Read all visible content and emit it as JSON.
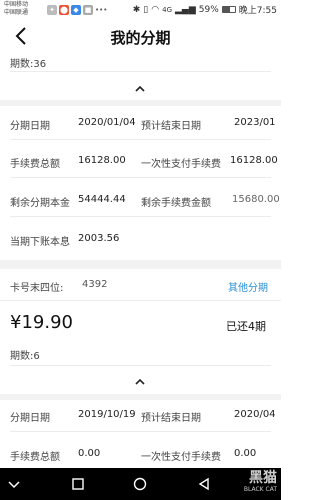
{
  "status_bar": {
    "carrier_1": "中国移动",
    "carrier_2": "中国联通",
    "battery": "59%",
    "time": "晚上7:55",
    "network": "4G"
  },
  "nav": {
    "title": "我的分期"
  },
  "plan_1": {
    "periods": "期数:36",
    "details": {
      "start_date_label": "分期日期",
      "start_date": "2020/01/04",
      "end_date_label": "预计结束日期",
      "end_date": "2023/01",
      "fee_total_label": "手续费总额",
      "fee_total": "16128.00",
      "one_time_fee_label": "一次性支付手续费",
      "one_time_fee": "16128.00",
      "remaining_principal_label": "剩余分期本金",
      "remaining_principal": "54444.44",
      "remaining_fee_label": "剩余手续费金额",
      "remaining_fee": "15680.00",
      "current_principal_label": "当期下账本息",
      "current_principal": "2003.56"
    }
  },
  "plan_2": {
    "card_label": "卡号末四位:",
    "card_last4": "4392",
    "other_link": "其他分期",
    "amount": "¥19.90",
    "status": "已还4期",
    "periods": "期数:6",
    "details": {
      "start_date_label": "分期日期",
      "start_date": "2019/10/19",
      "end_date_label": "预计结束日期",
      "end_date": "2020/04",
      "fee_total_label": "手续费总额",
      "fee_total": "0.00",
      "one_time_fee_label": "一次性支付手续费",
      "one_time_fee": "0.00"
    }
  },
  "watermark": {
    "text": "黑猫",
    "sub": "BLACK CAT"
  },
  "colors": {
    "accent": "#2b8fd6",
    "gap": "#f2f2f2",
    "nav_bg": "#000000"
  }
}
